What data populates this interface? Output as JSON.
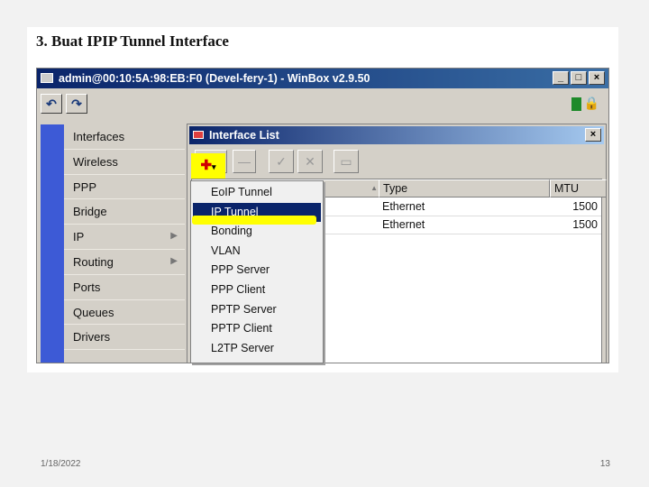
{
  "slide": {
    "heading": "3. Buat IPIP Tunnel Interface",
    "date": "1/18/2022",
    "page_number": "13"
  },
  "winbox": {
    "title": "admin@00:10:5A:98:EB:F0 (Devel-fery-1) - WinBox v2.9.50",
    "window_buttons": {
      "minimize": "_",
      "maximize": "□",
      "close": "×"
    },
    "toolbar": {
      "undo_icon": "↶",
      "redo_icon": "↷"
    },
    "status_indicator_color": "#1e8a2a",
    "lock_icon": "🔒"
  },
  "sidebar": {
    "items": [
      {
        "label": "Interfaces",
        "has_submenu": false
      },
      {
        "label": "Wireless",
        "has_submenu": false
      },
      {
        "label": "PPP",
        "has_submenu": false
      },
      {
        "label": "Bridge",
        "has_submenu": false
      },
      {
        "label": "IP",
        "has_submenu": true
      },
      {
        "label": "Routing",
        "has_submenu": true
      },
      {
        "label": "Ports",
        "has_submenu": false
      },
      {
        "label": "Queues",
        "has_submenu": false
      },
      {
        "label": "Drivers",
        "has_submenu": false
      }
    ]
  },
  "interface_list": {
    "title": "Interface List",
    "close": "×",
    "toolbar": {
      "add": "✚",
      "add_caret": "▾",
      "remove": "—",
      "enable": "✓",
      "disable": "✕",
      "comment": "▭"
    },
    "columns": {
      "name_sort": "▲",
      "type": "Type",
      "mtu": "MTU"
    },
    "rows": [
      {
        "type": "Ethernet",
        "mtu": "1500"
      },
      {
        "type": "Ethernet",
        "mtu": "1500"
      }
    ]
  },
  "add_menu": {
    "items": [
      {
        "label": "EoIP Tunnel",
        "selected": false
      },
      {
        "label": "IP Tunnel",
        "selected": true
      },
      {
        "label": "Bonding",
        "selected": false
      },
      {
        "label": "VLAN",
        "selected": false
      },
      {
        "label": "PPP Server",
        "selected": false
      },
      {
        "label": "PPP Client",
        "selected": false
      },
      {
        "label": "PPTP Server",
        "selected": false
      },
      {
        "label": "PPTP Client",
        "selected": false
      },
      {
        "label": "L2TP Server",
        "selected": false
      }
    ]
  },
  "colors": {
    "sidebar_strip": "#3d5ad6",
    "title_gradient_start": "#0a246a",
    "selection": "#0a246a",
    "highlight": "#ffff00",
    "add_icon": "#d00000"
  }
}
